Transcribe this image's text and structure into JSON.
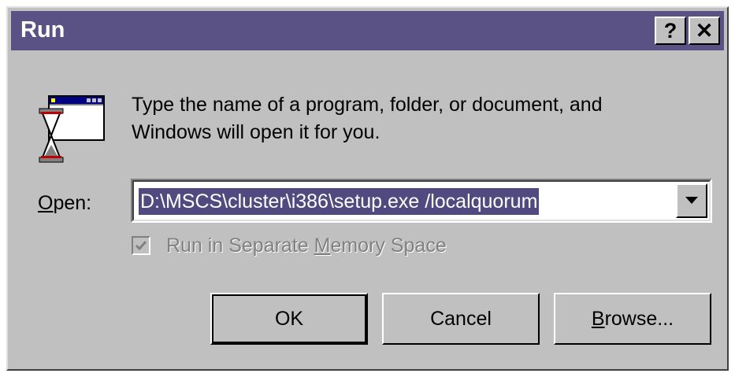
{
  "window": {
    "title": "Run"
  },
  "titlebar": {
    "help_label": "?",
    "close_label": "✕"
  },
  "description": {
    "line1": "Type the name of a program, folder, or document, and",
    "line2": "Windows will open it for you."
  },
  "open": {
    "label_underlined": "O",
    "label_rest": "pen:",
    "value": "D:\\MSCS\\cluster\\i386\\setup.exe /localquorum"
  },
  "checkbox": {
    "label_part1": "Run in Separate ",
    "label_underlined": "M",
    "label_part2": "emory Space",
    "checked": true,
    "enabled": false
  },
  "buttons": {
    "ok": "OK",
    "cancel": "Cancel",
    "browse_underlined": "B",
    "browse_rest": "rowse..."
  },
  "colors": {
    "titlebar": "#5a5285",
    "dialog_face": "#c0c0c0",
    "selection": "#504a80"
  },
  "icons": {
    "program": "run-program-icon",
    "help": "help-icon",
    "close": "close-icon",
    "dropdown": "chevron-down-icon",
    "check": "checkmark-icon"
  }
}
